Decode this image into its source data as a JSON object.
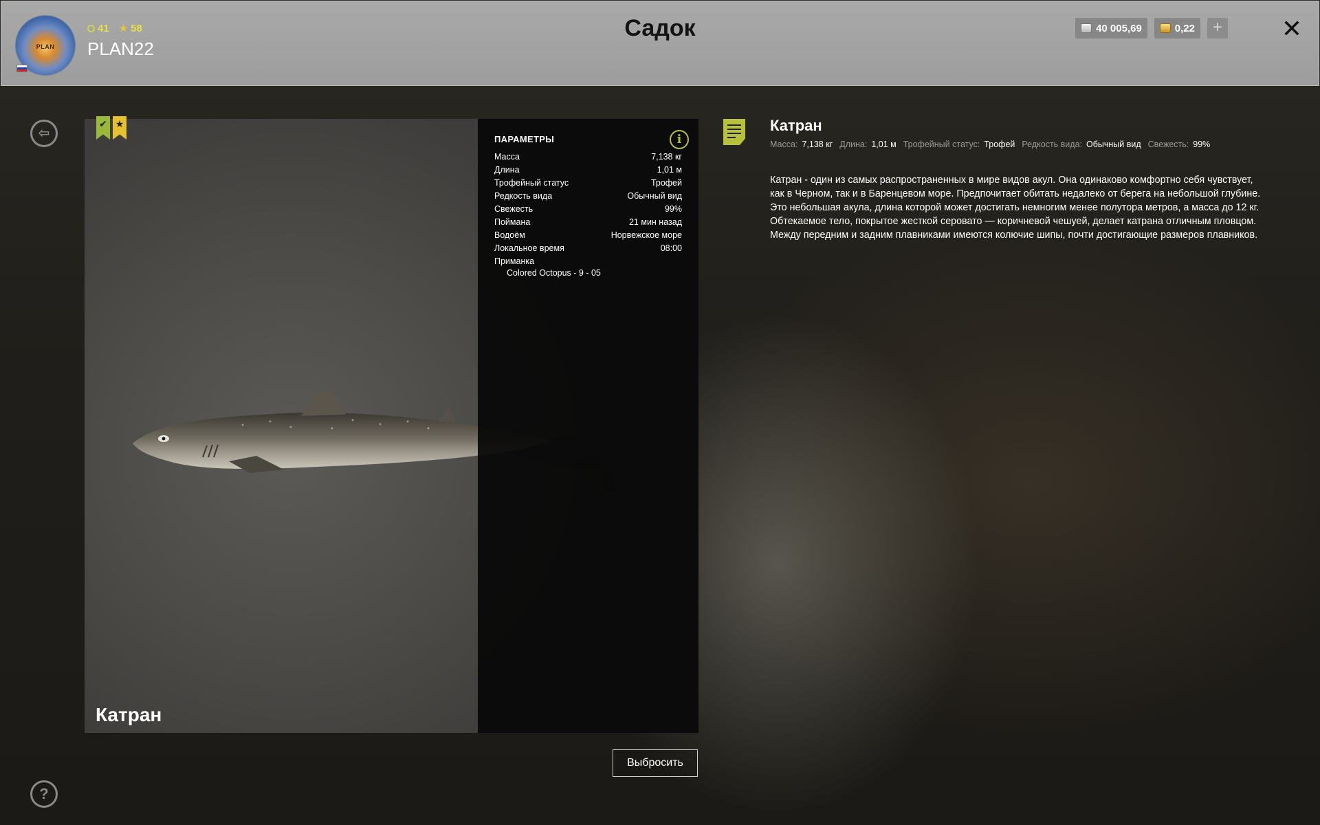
{
  "header": {
    "title": "Садок",
    "username": "PLAN22",
    "level": "41",
    "rank": "58",
    "avatar_text": "PLAN",
    "silver_balance": "40 005,69",
    "gold_balance": "0,22",
    "add_label": "+",
    "close_label": "✕"
  },
  "sidebar": {
    "back_icon": "⇦",
    "help_icon": "?"
  },
  "fish": {
    "name": "Катран",
    "badges": [
      "✔",
      "★"
    ],
    "colors": {
      "accent": "#b8c13a",
      "badge_check": "#9ab83a",
      "badge_star": "#e6c232"
    }
  },
  "params": {
    "title": "ПАРАМЕТРЫ",
    "rows": [
      {
        "label": "Масса",
        "value": "7,138 кг"
      },
      {
        "label": "Длина",
        "value": "1,01 м"
      },
      {
        "label": "Трофейный статус",
        "value": "Трофей"
      },
      {
        "label": "Редкость вида",
        "value": "Обычный вид"
      },
      {
        "label": "Свежесть",
        "value": "99%"
      },
      {
        "label": "Поймана",
        "value": "21 мин назад"
      },
      {
        "label": "Водоём",
        "value": "Норвежское море"
      },
      {
        "label": "Локальное время",
        "value": "08:00"
      }
    ],
    "bait_label": "Приманка",
    "bait_value": "Colored Octopus - 9 - 05"
  },
  "description": {
    "title": "Катран",
    "meta": [
      {
        "label": "Масса:",
        "value": "7,138 кг"
      },
      {
        "label": "Длина:",
        "value": "1,01 м"
      },
      {
        "label": "Трофейный статус:",
        "value": "Трофей"
      },
      {
        "label": "Редкость вида:",
        "value": "Обычный вид"
      },
      {
        "label": "Свежесть:",
        "value": "99%"
      }
    ],
    "lines": [
      "Катран - один из самых распространенных в мире видов акул. Она одинаково комфортно себя чувствует,",
      "как в Черном, так и в Баренцевом море. Предпочитает обитать недалеко от берега на небольшой глубине.",
      "Это небольшая акула, длина которой может достигать немногим менее полутора метров, а масса до 12 кг.",
      "Обтекаемое тело, покрытое жесткой серовато — коричневой чешуей, делает катрана отличным пловцом.",
      "Между передним и задним плавниками имеются колючие шипы, почти достигающие размеров плавников."
    ]
  },
  "actions": {
    "discard_label": "Выбросить"
  }
}
